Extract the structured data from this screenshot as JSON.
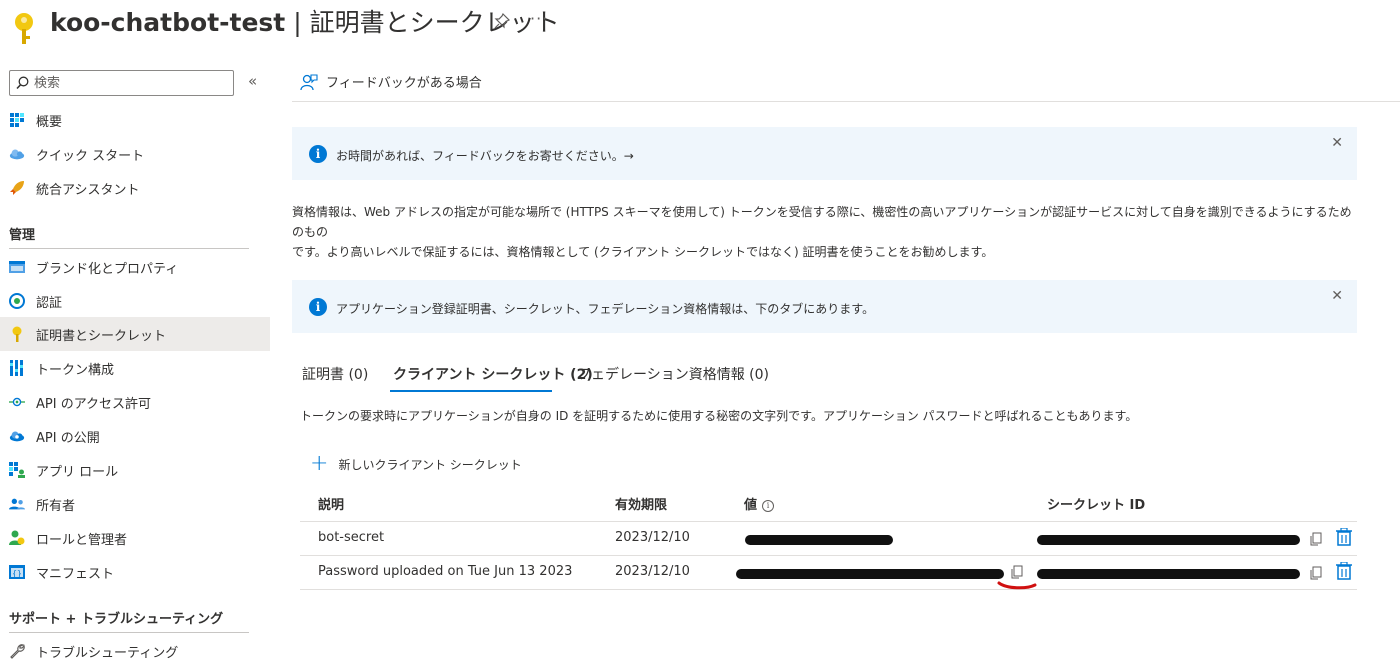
{
  "header": {
    "app_name": "koo-chatbot-test",
    "separator": " | ",
    "page_name": "証明書とシークレット",
    "pin_icon": "pin-icon",
    "more_label": "···"
  },
  "sidebar": {
    "search_placeholder": "検索",
    "collapse_label": "«",
    "items_top": [
      {
        "label": "概要",
        "icon": "overview-icon"
      },
      {
        "label": "クイック スタート",
        "icon": "quickstart-cloud-icon"
      },
      {
        "label": "統合アシスタント",
        "icon": "rocket-icon"
      }
    ],
    "section_manage": "管理",
    "items_manage": [
      {
        "label": "ブランド化とプロパティ",
        "icon": "branding-icon"
      },
      {
        "label": "認証",
        "icon": "authentication-icon"
      },
      {
        "label": "証明書とシークレット",
        "icon": "key-icon",
        "active": true
      },
      {
        "label": "トークン構成",
        "icon": "token-config-icon"
      },
      {
        "label": "API のアクセス許可",
        "icon": "api-permissions-icon"
      },
      {
        "label": "API の公開",
        "icon": "expose-api-icon"
      },
      {
        "label": "アプリ ロール",
        "icon": "app-roles-icon"
      },
      {
        "label": "所有者",
        "icon": "owners-icon"
      },
      {
        "label": "ロールと管理者",
        "icon": "roles-admins-icon"
      },
      {
        "label": "マニフェスト",
        "icon": "manifest-icon"
      }
    ],
    "section_support": "サポート + トラブルシューティング",
    "items_support": [
      {
        "label": "トラブルシューティング",
        "icon": "wrench-icon"
      }
    ]
  },
  "command_bar": {
    "feedback_label": "フィードバックがある場合"
  },
  "banners": {
    "feedback_text": "お時間があれば、フィードバックをお寄せください。→",
    "tabs_info_text": "アプリケーション登録証明書、シークレット、フェデレーション資格情報は、下のタブにあります。",
    "close_label": "✕"
  },
  "description": {
    "line1": "資格情報は、Web アドレスの指定が可能な場所で (HTTPS スキーマを使用して) トークンを受信する際に、機密性の高いアプリケーションが認証サービスに対して自身を識別できるようにするためのもの",
    "line2": "です。より高いレベルで保証するには、資格情報として (クライアント シークレットではなく) 証明書を使うことをお勧めします。"
  },
  "tabs": [
    {
      "label": "証明書 (0)"
    },
    {
      "label": "クライアント シークレット (2)",
      "active": true
    },
    {
      "label": "フェデレーション資格情報 (0)"
    }
  ],
  "tab_description": "トークンの要求時にアプリケーションが自身の ID を証明するために使用する秘密の文字列です。アプリケーション パスワードと呼ばれることもあります。",
  "new_secret_label": "新しいクライアント シークレット",
  "table": {
    "headers": {
      "description": "説明",
      "expires": "有効期限",
      "value": "値",
      "secret_id": "シークレット ID"
    },
    "rows": [
      {
        "description": "bot-secret",
        "expires": "2023/12/10"
      },
      {
        "description": "Password uploaded on Tue Jun 13 2023",
        "expires": "2023/12/10"
      }
    ]
  },
  "colors": {
    "accent": "#0078d4",
    "info_bg": "#eff6fc",
    "active_nav_bg": "#edebe9",
    "redaction": "#111111",
    "annotation_red": "#d01010"
  }
}
